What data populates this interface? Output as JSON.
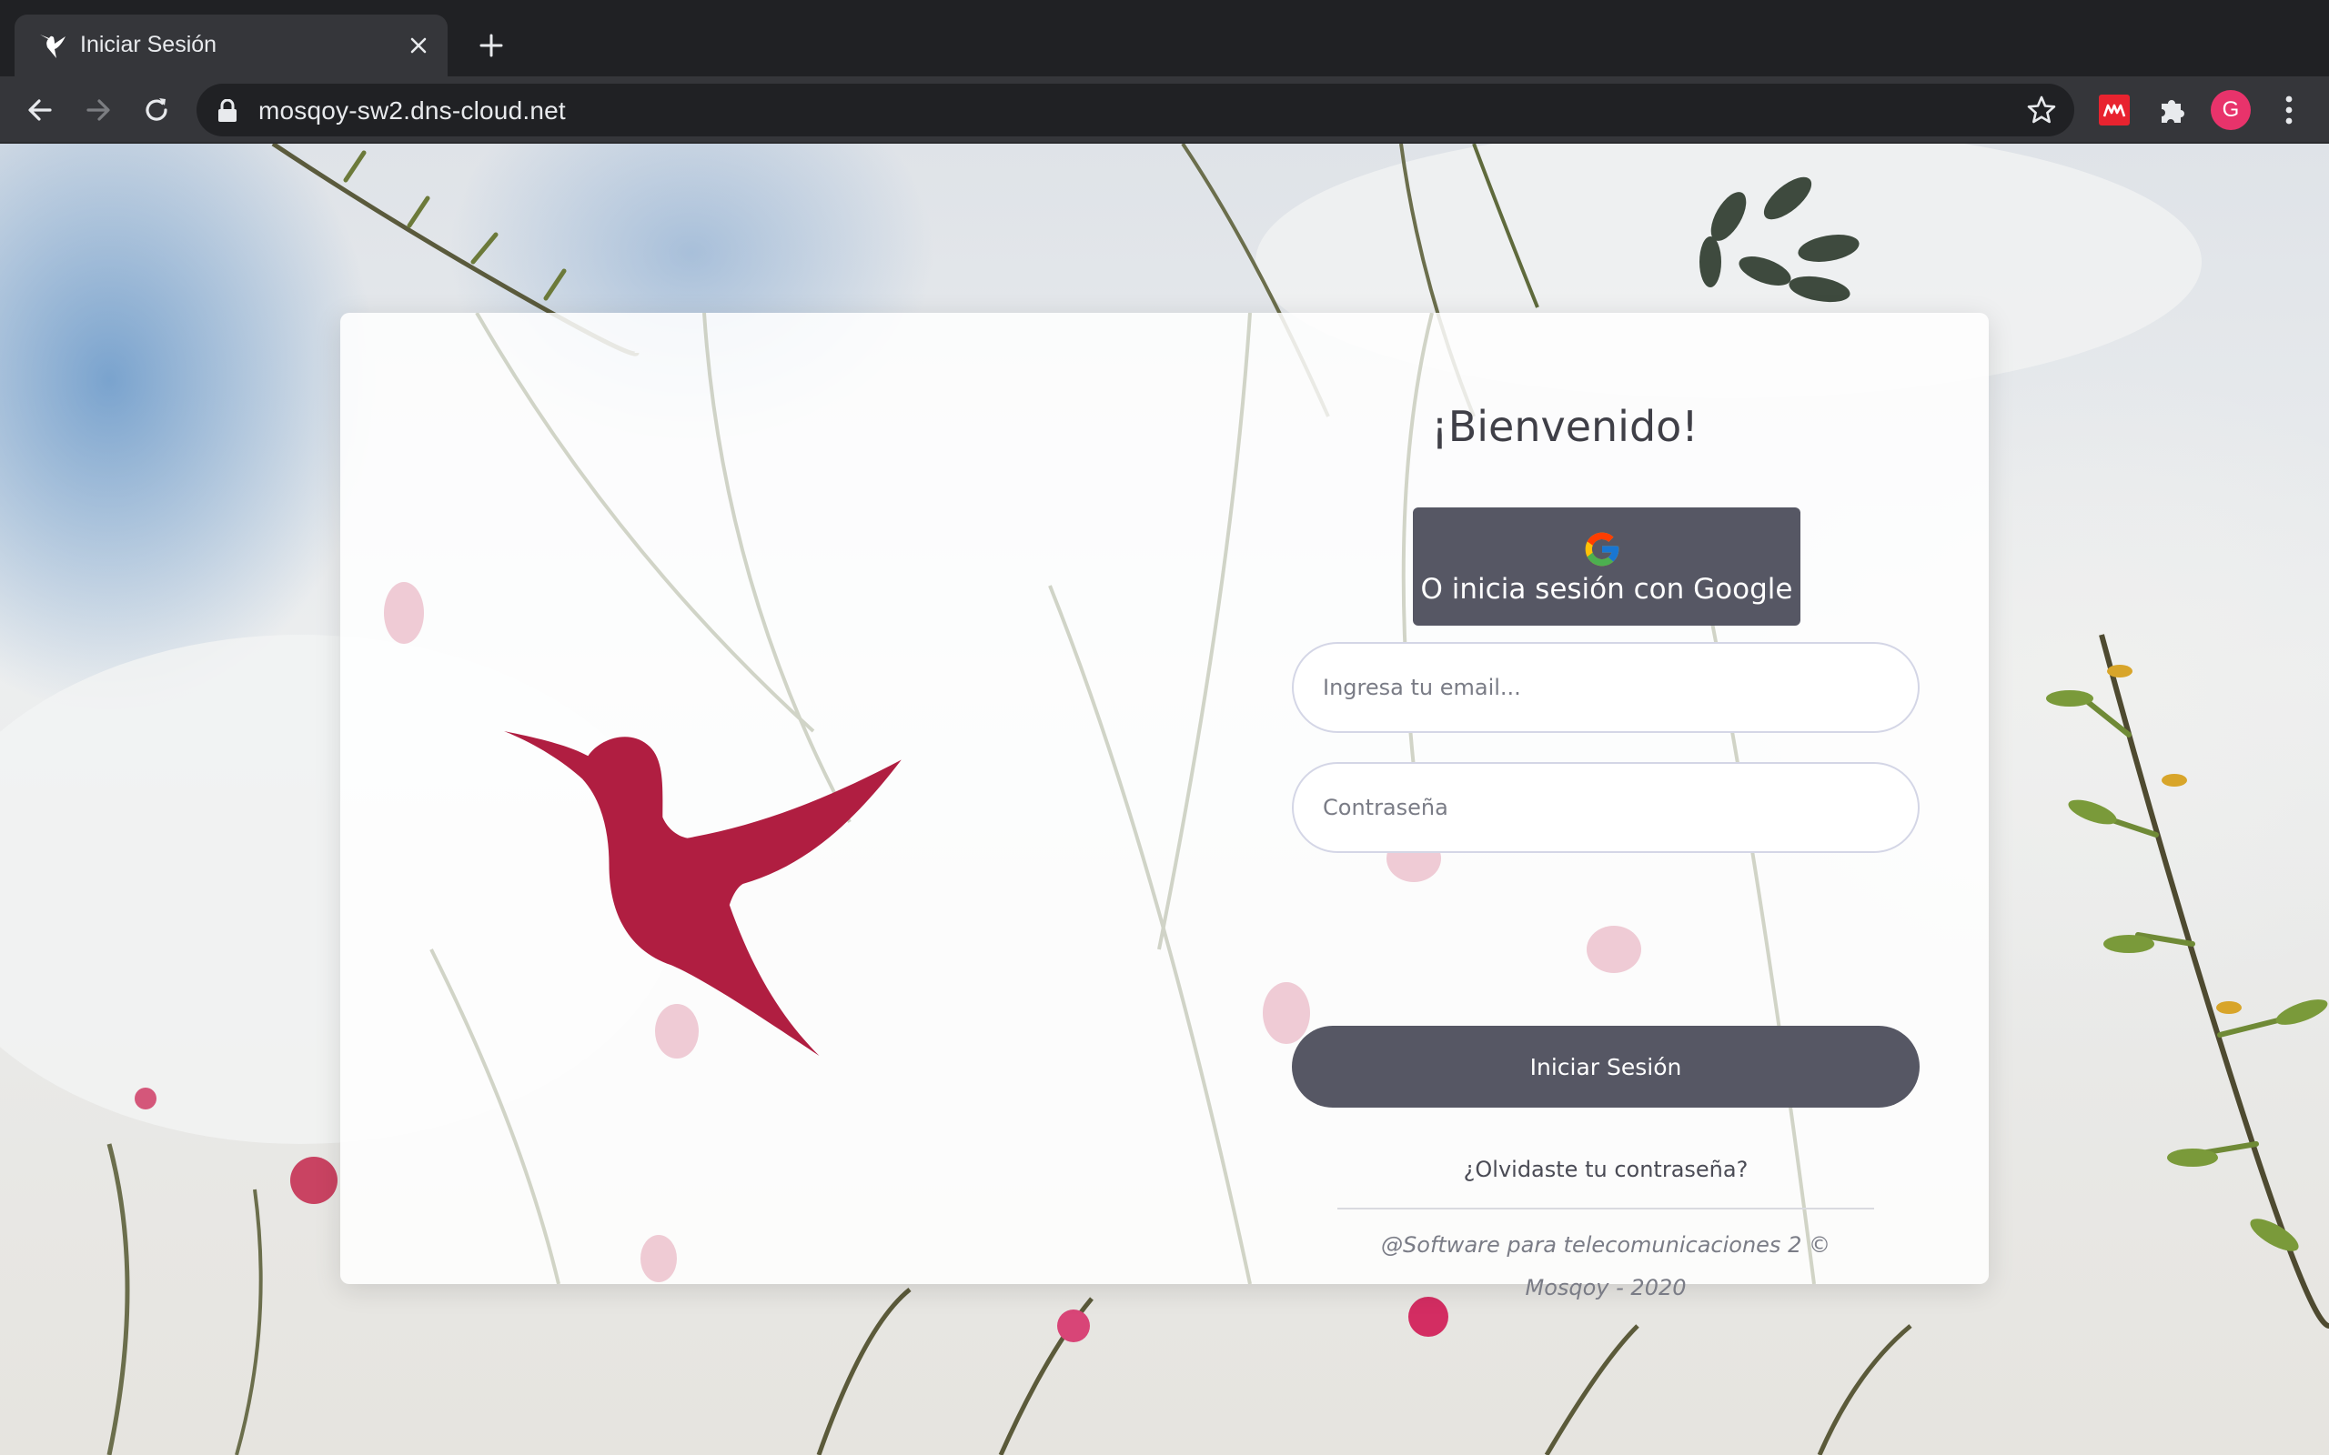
{
  "browser": {
    "tab_title": "Iniciar Sesión",
    "url": "mosqoy-sw2.dns-cloud.net",
    "profile_initial": "G"
  },
  "login": {
    "welcome": "¡Bienvenido!",
    "google_button": "O inicia sesión con Google",
    "email_placeholder": "Ingresa tu email...",
    "password_placeholder": "Contraseña",
    "submit": "Iniciar Sesión",
    "forgot_password": "¿Olvidaste tu contraseña?",
    "footer": "@Software para telecomunicaciones 2 © Mosqoy - 2020"
  },
  "colors": {
    "brand_red": "#b01e41",
    "button_gray": "#565764",
    "chrome_dark": "#202124",
    "chrome_toolbar": "#35363a"
  },
  "icons": [
    "hummingbird-favicon-icon",
    "close-icon",
    "plus-icon",
    "back-arrow-icon",
    "forward-arrow-icon",
    "reload-icon",
    "lock-icon",
    "star-icon",
    "extension-red-icon",
    "puzzle-icon",
    "avatar",
    "menu-dots-icon",
    "google-icon",
    "hummingbird-logo"
  ]
}
